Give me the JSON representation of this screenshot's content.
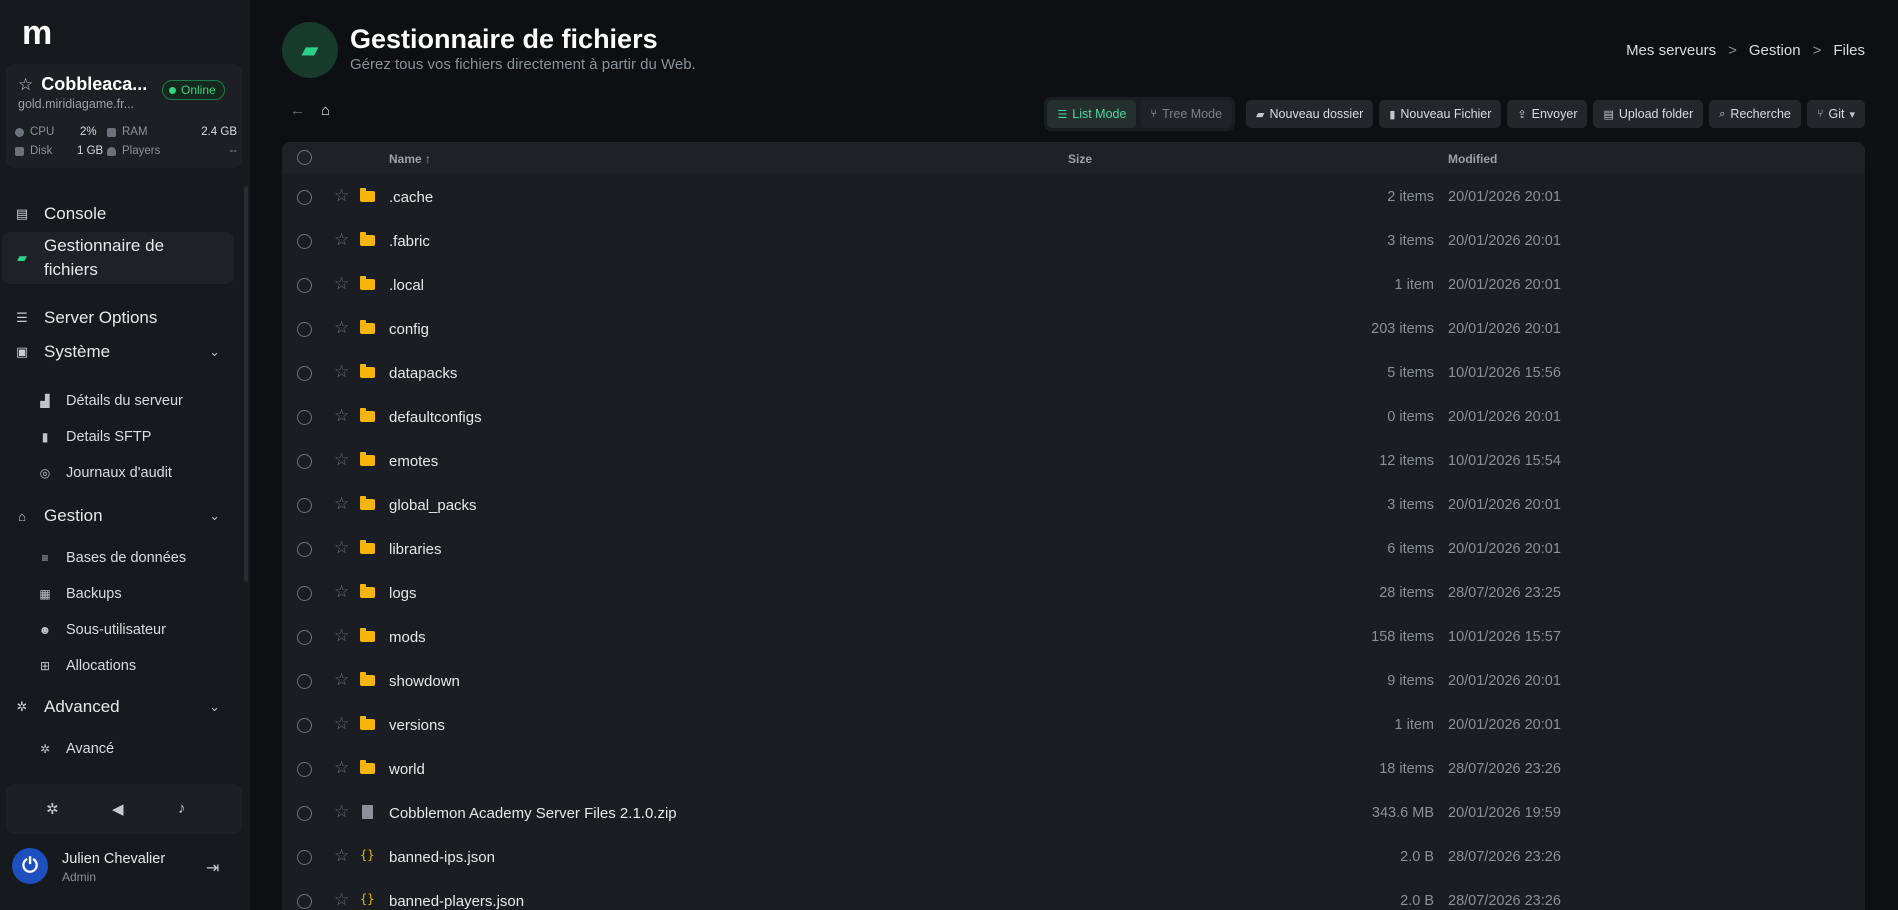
{
  "sidebar": {
    "logo": "m",
    "server": {
      "name": "Cobbleaca...",
      "status": "Online",
      "host": "gold.miridiagame.fr...",
      "stats": {
        "cpu_label": "CPU",
        "cpu_value": "2%",
        "ram_label": "RAM",
        "ram_value": "2.4 GB",
        "disk_label": "Disk",
        "disk_value": "1 GB",
        "players_label": "Players",
        "players_value": "--"
      }
    },
    "nav": {
      "console": "Console",
      "file_manager_line1": "Gestionnaire de",
      "file_manager_line2": "fichiers",
      "server_options": "Server Options",
      "systeme": "Système",
      "details_serveur": "Détails du serveur",
      "details_sftp": "Details SFTP",
      "journaux": "Journaux d'audit",
      "gestion": "Gestion",
      "bases": "Bases de données",
      "backups": "Backups",
      "sous_utilisateur": "Sous-utilisateur",
      "allocations": "Allocations",
      "advanced": "Advanced",
      "avance": "Avancé"
    },
    "user": {
      "name": "Julien Chevalier",
      "role": "Admin"
    }
  },
  "header": {
    "title": "Gestionnaire de fichiers",
    "subtitle": "Gérez tous vos fichiers directement à partir du Web.",
    "breadcrumb": [
      "Mes serveurs",
      "Gestion",
      "Files"
    ]
  },
  "toolbar": {
    "list_mode": "List Mode",
    "tree_mode": "Tree Mode",
    "new_folder": "Nouveau dossier",
    "new_file": "Nouveau Fichier",
    "upload": "Envoyer",
    "upload_folder": "Upload folder",
    "search": "Recherche",
    "git": "Git"
  },
  "table": {
    "columns": {
      "name": "Name ↑",
      "size": "Size",
      "modified": "Modified"
    },
    "rows": [
      {
        "name": ".cache",
        "size": "2 items",
        "modified": "20/01/2026 20:01",
        "type": "folder"
      },
      {
        "name": ".fabric",
        "size": "3 items",
        "modified": "20/01/2026 20:01",
        "type": "folder"
      },
      {
        "name": ".local",
        "size": "1 item",
        "modified": "20/01/2026 20:01",
        "type": "folder"
      },
      {
        "name": "config",
        "size": "203 items",
        "modified": "20/01/2026 20:01",
        "type": "folder"
      },
      {
        "name": "datapacks",
        "size": "5 items",
        "modified": "10/01/2026 15:56",
        "type": "folder"
      },
      {
        "name": "defaultconfigs",
        "size": "0 items",
        "modified": "20/01/2026 20:01",
        "type": "folder"
      },
      {
        "name": "emotes",
        "size": "12 items",
        "modified": "10/01/2026 15:54",
        "type": "folder"
      },
      {
        "name": "global_packs",
        "size": "3 items",
        "modified": "20/01/2026 20:01",
        "type": "folder"
      },
      {
        "name": "libraries",
        "size": "6 items",
        "modified": "20/01/2026 20:01",
        "type": "folder"
      },
      {
        "name": "logs",
        "size": "28 items",
        "modified": "28/07/2026 23:25",
        "type": "folder"
      },
      {
        "name": "mods",
        "size": "158 items",
        "modified": "10/01/2026 15:57",
        "type": "folder"
      },
      {
        "name": "showdown",
        "size": "9 items",
        "modified": "20/01/2026 20:01",
        "type": "folder"
      },
      {
        "name": "versions",
        "size": "1 item",
        "modified": "20/01/2026 20:01",
        "type": "folder"
      },
      {
        "name": "world",
        "size": "18 items",
        "modified": "28/07/2026 23:26",
        "type": "folder"
      },
      {
        "name": "Cobblemon Academy Server Files 2.1.0.zip",
        "size": "343.6 MB",
        "modified": "20/01/2026 19:59",
        "type": "file"
      },
      {
        "name": "banned-ips.json",
        "size": "2.0 B",
        "modified": "28/07/2026 23:26",
        "type": "json"
      },
      {
        "name": "banned-players.json",
        "size": "2.0 B",
        "modified": "28/07/2026 23:26",
        "type": "json"
      }
    ]
  }
}
